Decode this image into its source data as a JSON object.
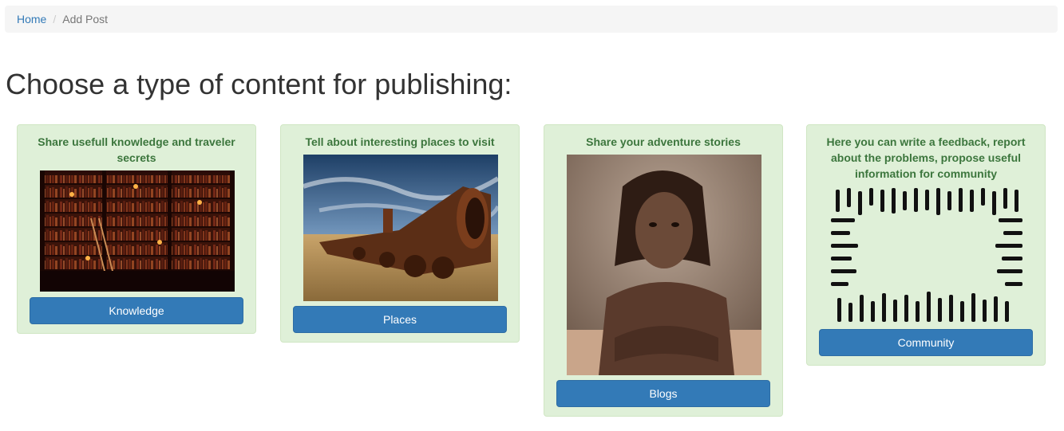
{
  "breadcrumb": {
    "home": "Home",
    "separator": "/",
    "current": "Add Post"
  },
  "page_title": "Choose a type of content for publishing:",
  "cards": [
    {
      "title": "Share usefull knowledge and traveler secrets",
      "image": "library-bookshelves-image",
      "button": "Knowledge"
    },
    {
      "title": "Tell about interesting places to visit",
      "image": "rusty-locomotive-image",
      "button": "Places"
    },
    {
      "title": "Share your adventure stories",
      "image": "adventurer-portrait-image",
      "button": "Blogs"
    },
    {
      "title": "Here you can write a feedback, report about the problems, propose useful information for community",
      "image": "hands-frame-image",
      "button": "Community"
    }
  ],
  "colors": {
    "card_bg": "#dff0d8",
    "card_title": "#3c763d",
    "button_bg": "#337ab7",
    "link": "#337ab7"
  }
}
